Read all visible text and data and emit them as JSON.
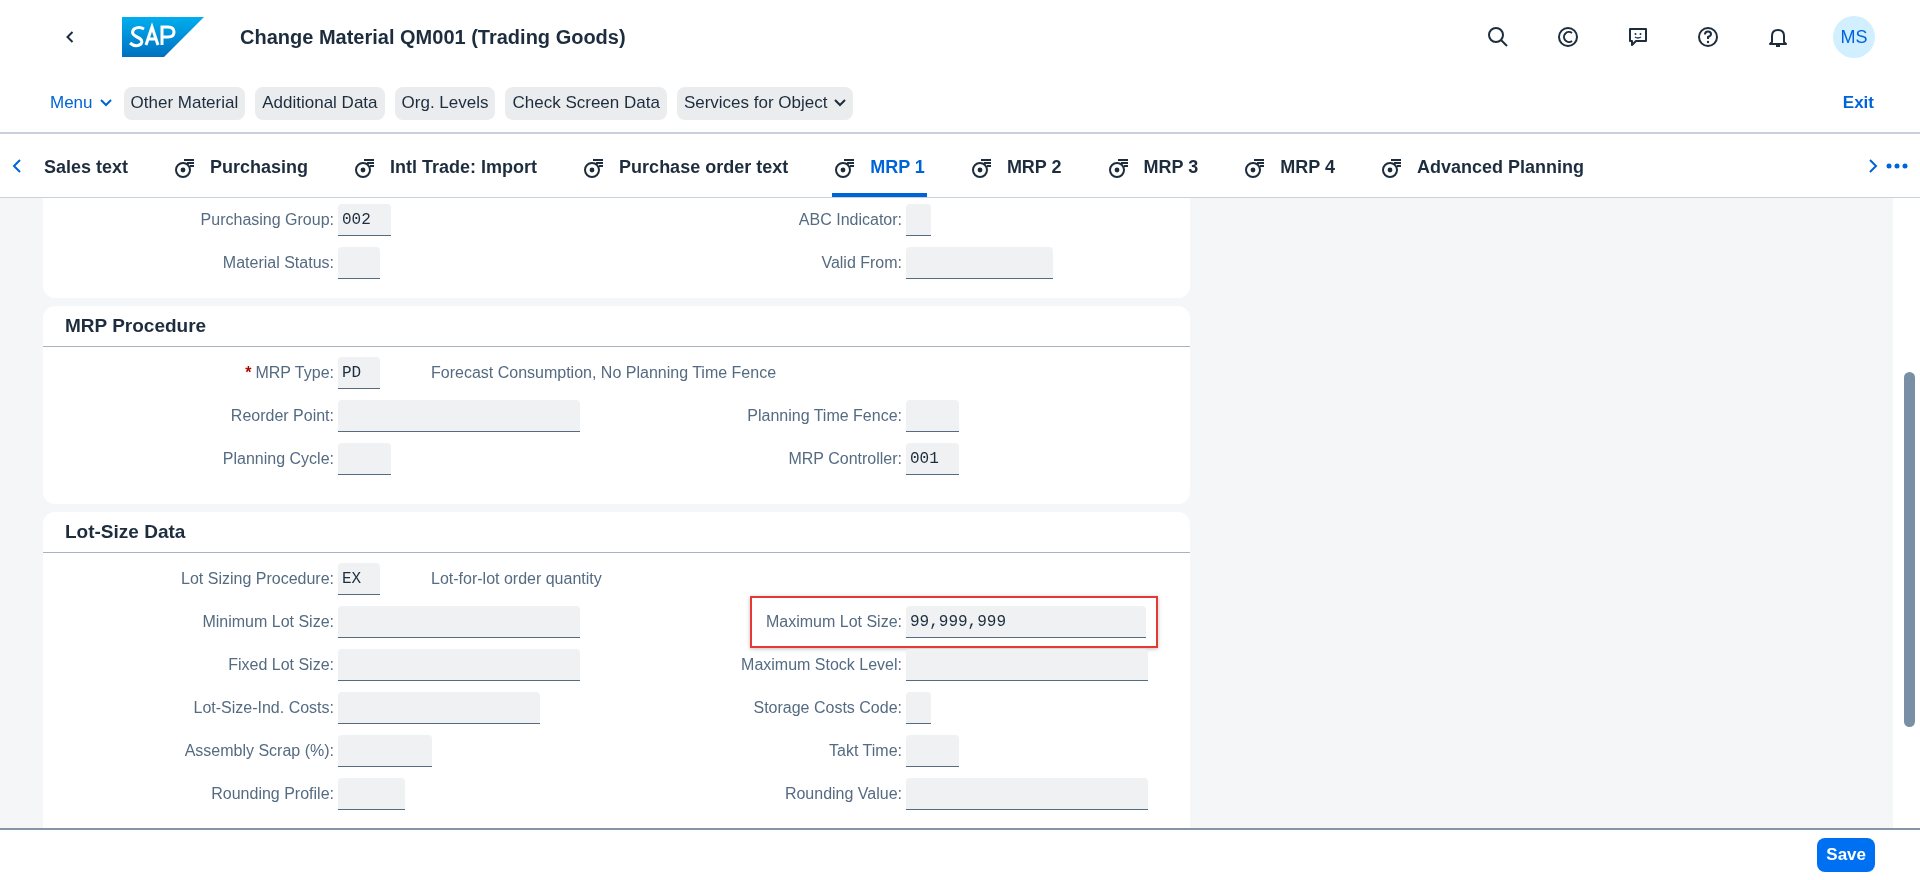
{
  "header": {
    "title": "Change Material QM001 (Trading Goods)",
    "avatar": "MS"
  },
  "toolbar": {
    "menu": "Menu",
    "buttons": [
      {
        "label": "Other Material",
        "dropdown": false
      },
      {
        "label": "Additional Data",
        "dropdown": false
      },
      {
        "label": "Org. Levels",
        "dropdown": false
      },
      {
        "label": "Check Screen Data",
        "dropdown": false
      },
      {
        "label": "Services for Object",
        "dropdown": true
      }
    ],
    "exit": "Exit"
  },
  "tabs": [
    {
      "label": "Sales text",
      "selected": false,
      "has_icon": false
    },
    {
      "label": "Purchasing",
      "selected": false,
      "has_icon": true
    },
    {
      "label": "Intl Trade: Import",
      "selected": false,
      "has_icon": true
    },
    {
      "label": "Purchase order text",
      "selected": false,
      "has_icon": true
    },
    {
      "label": "MRP 1",
      "selected": true,
      "has_icon": true
    },
    {
      "label": "MRP 2",
      "selected": false,
      "has_icon": true
    },
    {
      "label": "MRP 3",
      "selected": false,
      "has_icon": true
    },
    {
      "label": "MRP 4",
      "selected": false,
      "has_icon": true
    },
    {
      "label": "Advanced Planning",
      "selected": false,
      "has_icon": true
    }
  ],
  "sections": [
    {
      "rows": [
        {
          "left": {
            "label": "Purchasing Group:",
            "value": "002"
          },
          "right": {
            "label": "ABC Indicator:"
          }
        },
        {
          "left": {
            "label": "Material Status:"
          },
          "right": {
            "label": "Valid From:"
          }
        }
      ]
    },
    {
      "title": "MRP Procedure",
      "rows": [
        {
          "left": {
            "label": "MRP Type:",
            "value": "PD",
            "required_mark": "*",
            "description": "Forecast Consumption, No Planning Time Fence"
          }
        },
        {
          "left": {
            "label": "Reorder Point:"
          },
          "right": {
            "label": "Planning Time Fence:"
          }
        },
        {
          "left": {
            "label": "Planning Cycle:"
          },
          "right": {
            "label": "MRP Controller:",
            "value": "001"
          }
        }
      ]
    },
    {
      "title": "Lot-Size Data",
      "rows": [
        {
          "left": {
            "label": "Lot Sizing Procedure:",
            "value": "EX",
            "description": "Lot-for-lot order quantity"
          }
        },
        {
          "left": {
            "label": "Minimum Lot Size:"
          },
          "right": {
            "label": "Maximum Lot Size:",
            "value": "99,999,999",
            "highlighted": true
          }
        },
        {
          "left": {
            "label": "Fixed Lot Size:"
          },
          "right": {
            "label": "Maximum Stock Level:"
          }
        },
        {
          "left": {
            "label": "Lot-Size-Ind. Costs:"
          },
          "right": {
            "label": "Storage Costs Code:"
          }
        },
        {
          "left": {
            "label": "Assembly Scrap (%):"
          },
          "right": {
            "label": "Takt Time:"
          }
        },
        {
          "left": {
            "label": "Rounding Profile:"
          },
          "right": {
            "label": "Rounding Value:"
          }
        }
      ]
    }
  ],
  "footer": {
    "save": "Save"
  }
}
